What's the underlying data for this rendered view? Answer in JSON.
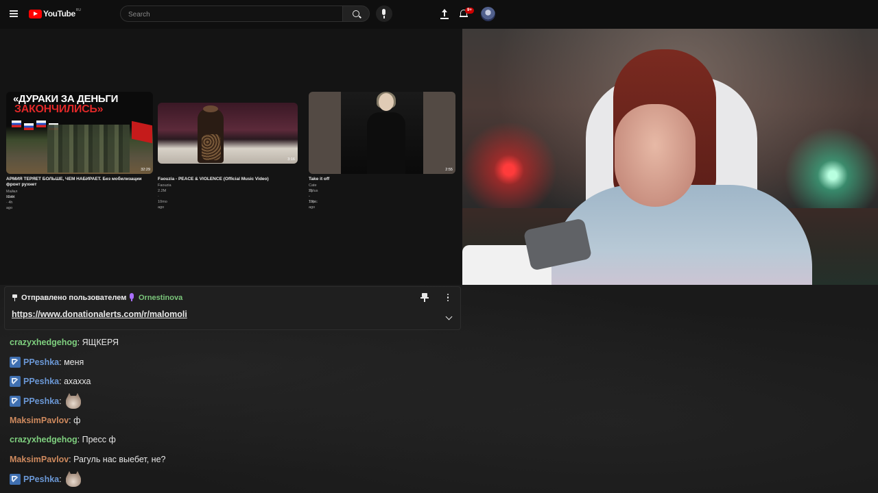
{
  "youtube": {
    "logo_text": "YouTube",
    "region": "RU",
    "search_placeholder": "Search",
    "notification_count": "9+",
    "videos": [
      {
        "thumb_line1": "«ДУРАКИ ЗА ДЕНЬГИ",
        "thumb_line2": "ЗАКОНЧИЛИСЬ»",
        "duration": "32:29",
        "title": "АРМИЯ ТЕРЯЕТ БОЛЬШЕ, ЧЕМ НАБИРАЕТ. Без мобилизации фронт рухнет",
        "channel": "Майкл Наки",
        "meta": "324K · 4h ago"
      },
      {
        "duration": "3:16",
        "title": "Faouzia - PEACE & VIOLENCE (Official Music Video)",
        "channel": "Faouzia",
        "meta": "2.2M · 10mo ago"
      },
      {
        "duration": "2:55",
        "title": "Take it off",
        "channel": "Cate Sylus - Topic",
        "meta": "21 · 10h ago"
      }
    ]
  },
  "chat": {
    "pinned": {
      "label": "Отправлено пользователем",
      "user": "Ornestinova",
      "link": "https://www.donationalerts.com/r/malomoli"
    },
    "messages": [
      {
        "user": "crazyxhedgehog",
        "text": ": ЯЩКЕРЯ"
      },
      {
        "user": "PPeshka",
        "text": ": меня"
      },
      {
        "user": "PPeshka",
        "text": ": ахахха"
      },
      {
        "user": "PPeshka",
        "text": ":"
      },
      {
        "user": "MaksimPavlov",
        "text": ": ф"
      },
      {
        "user": "crazyxhedgehog",
        "text": ": Пресс ф"
      },
      {
        "user": "MaksimPavlov",
        "text": ": Рагуль нас выебет, не?"
      },
      {
        "user": "PPeshka",
        "text": ":"
      }
    ]
  },
  "colors": {
    "user_green": "#7fd07f",
    "user_blue": "#6b98d6",
    "user_orange": "#cf8a5e",
    "badge_purple": "#a970ff",
    "youtube_red": "#ff0000"
  }
}
